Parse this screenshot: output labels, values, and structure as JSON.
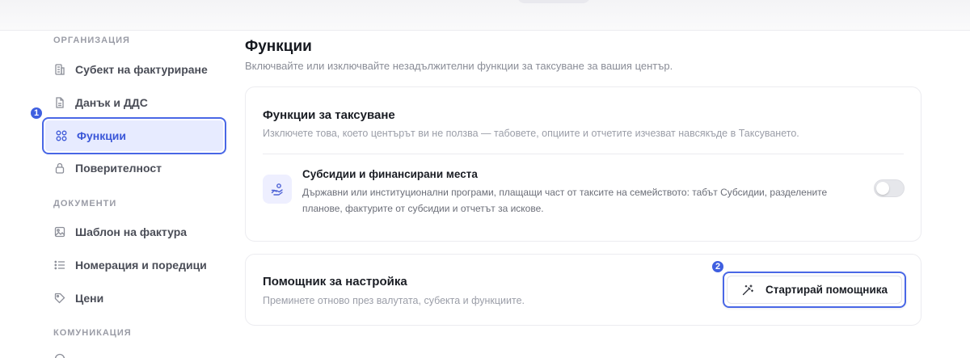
{
  "sidebar": {
    "sections": [
      "ОРГАНИЗАЦИЯ",
      "ДОКУМЕНТИ",
      "КОМУНИКАЦИЯ"
    ],
    "items": [
      {
        "label": "Субект на фактуриране",
        "icon": "building-icon"
      },
      {
        "label": "Данък и ДДС",
        "icon": "document-icon"
      },
      {
        "label": "Функции",
        "icon": "grid-icon",
        "active": true
      },
      {
        "label": "Поверителност",
        "icon": "lock-icon"
      },
      {
        "label": "Шаблон на фактура",
        "icon": "image-icon"
      },
      {
        "label": "Номерация и поредици",
        "icon": "list-icon"
      },
      {
        "label": "Цени",
        "icon": "tag-icon"
      }
    ]
  },
  "badges": [
    "1",
    "2"
  ],
  "main": {
    "title": "Функции",
    "subtitle": "Включвайте или изключвайте незадължителни функции за таксуване за вашия център.",
    "billing_card": {
      "title": "Функции за таксуване",
      "subtitle": "Изключете това, което центърът ви не ползва — табовете, опциите и отчетите изчезват навсякъде в Таксуването.",
      "feature": {
        "title": "Субсидии и финансирани места",
        "description": "Държавни или институционални програми, плащащи част от таксите на семейството: табът Субсидии, разделените планове, фактурите от субсидии и отчетът за искове.",
        "enabled": false
      }
    },
    "wizard_card": {
      "title": "Помощник за настройка",
      "subtitle": "Преминете отново през валутата, субекта и функциите.",
      "button_label": "Стартирай помощника"
    }
  },
  "colors": {
    "accent": "#4967e6",
    "active_bg": "#e7ebff",
    "badge": "#3f5fe0"
  }
}
